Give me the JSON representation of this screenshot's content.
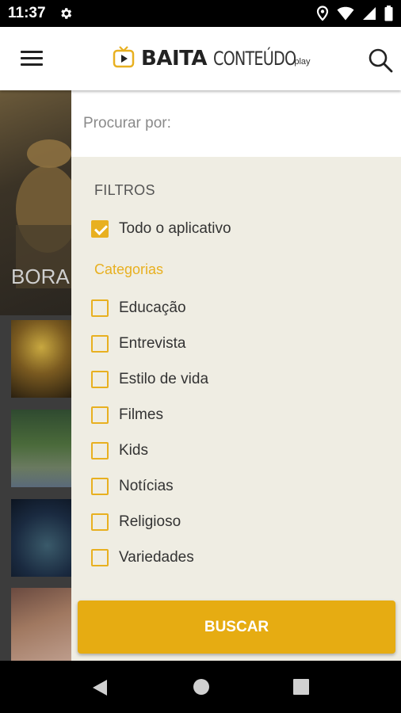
{
  "status_bar": {
    "time": "11:37"
  },
  "app_bar": {
    "logo_main": "BAITA",
    "logo_secondary": "CONTEÚDO",
    "logo_tag": "play"
  },
  "background": {
    "hero_title": "BORA"
  },
  "drawer": {
    "search_placeholder": "Procurar por:",
    "filters_heading": "FILTROS",
    "all_app_label": "Todo o aplicativo",
    "all_app_checked": true,
    "categories_heading": "Categorias",
    "categories": [
      {
        "label": "Educação",
        "checked": false
      },
      {
        "label": "Entrevista",
        "checked": false
      },
      {
        "label": "Estilo de vida",
        "checked": false
      },
      {
        "label": "Filmes",
        "checked": false
      },
      {
        "label": "Kids",
        "checked": false
      },
      {
        "label": "Notícias",
        "checked": false
      },
      {
        "label": "Religioso",
        "checked": false
      },
      {
        "label": "Variedades",
        "checked": false
      }
    ],
    "search_button": "BUSCAR"
  },
  "colors": {
    "accent": "#e8b020",
    "button": "#e6ac12",
    "drawer_bg": "#efede3"
  }
}
